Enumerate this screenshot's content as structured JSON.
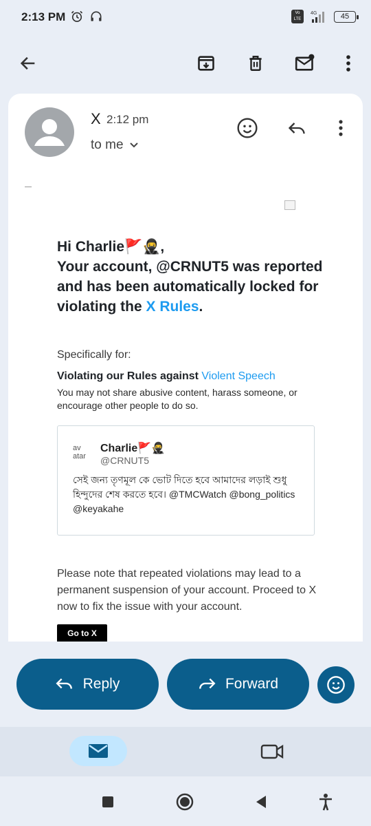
{
  "status": {
    "time": "2:13 PM",
    "network": "4G",
    "volte": "Vo LTE",
    "battery": "45"
  },
  "toolbar": {
    "back_icon": "arrow-back-icon",
    "archive_icon": "archive-icon",
    "delete_icon": "trash-icon",
    "unread_icon": "mark-unread-icon",
    "more_icon": "more-vert-icon"
  },
  "email": {
    "sender": "X",
    "time": "2:12 pm",
    "recipient": "to me",
    "greeting_line1": "Hi Charlie🚩🥷,",
    "greeting_line2_prefix": "Your account, @CRNUT5 was reported and has been automatically locked for violating the ",
    "greeting_link": "X Rules",
    "greeting_suffix": ".",
    "specifically": "Specifically for:",
    "violation_prefix": "Violating our Rules against ",
    "violation_link": "Violent Speech",
    "violation_desc": "You may not share abusive content, harass someone, or encourage other people to do so.",
    "tweet": {
      "avatar_alt": "av atar",
      "name": "Charlie🚩🥷",
      "handle": "@CRNUT5",
      "text": "সেই জন্য তৃণমূল কে ভোট দিতে হবে আমাদের লড়াই শুধু হিন্দুদের শেষ করতে হবে। @TMCWatch @bong_politics @keyakahe"
    },
    "note": "Please note that repeated violations may lead to a permanent suspension of your account. Proceed to X now to fix the issue with your account.",
    "cta": "Go to X"
  },
  "actions": {
    "reply": "Reply",
    "forward": "Forward"
  },
  "colors": {
    "link": "#1d9bf0",
    "button": "#0b5e8c",
    "nav_active": "#c2e7ff"
  }
}
